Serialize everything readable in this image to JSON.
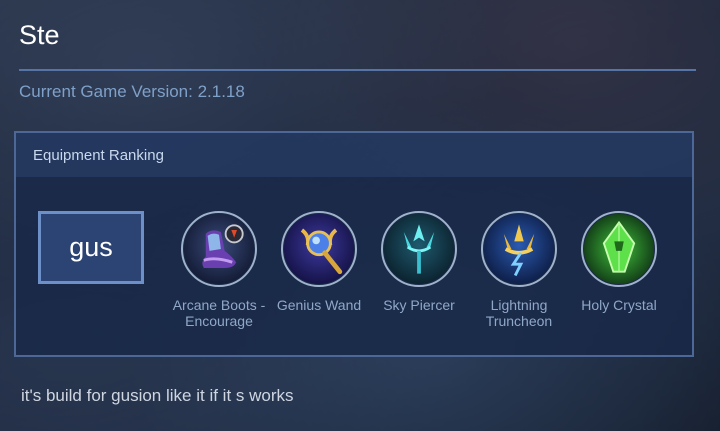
{
  "header": {
    "hero_name": "Ste",
    "version_text": "Current Game Version: 2.1.18"
  },
  "panel": {
    "title": "Equipment Ranking",
    "hero_tag": "gus"
  },
  "items": [
    {
      "name": "Arcane Boots - Encourage",
      "icon": "boots-icon"
    },
    {
      "name": "Genius Wand",
      "icon": "wand-icon"
    },
    {
      "name": "Sky Piercer",
      "icon": "trident-icon"
    },
    {
      "name": "Lightning Truncheon",
      "icon": "lightning-trident-icon"
    },
    {
      "name": "Holy Crystal",
      "icon": "crystal-icon"
    }
  ],
  "note": "it's build for gusion like it if it s works"
}
